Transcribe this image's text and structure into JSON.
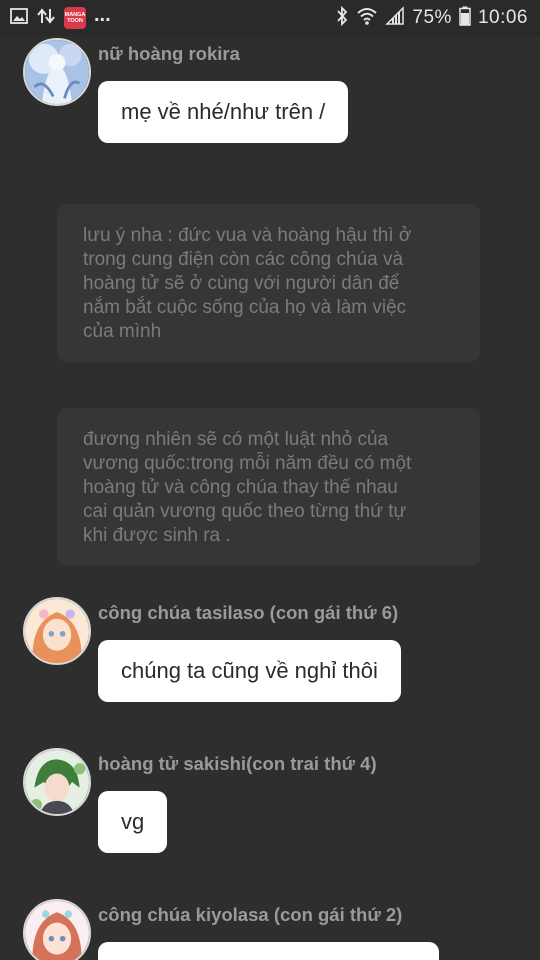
{
  "status_bar": {
    "left_icons": [
      "image-icon",
      "data-transfer-icon",
      "manga-toon-app-icon"
    ],
    "app_badge_text": [
      "MANGA",
      "TOON"
    ],
    "more": "...",
    "right_icons": [
      "bluetooth-icon",
      "wifi-icon",
      "signal-icon",
      "battery-icon"
    ],
    "battery": "75%",
    "time": "10:06"
  },
  "colors": {
    "background": "#2e2e2e",
    "bubble": "#ffffff",
    "narration_bg": "#363636",
    "sender_text": "#9a9a9a",
    "narration_text": "#7b7b7b"
  },
  "messages": [
    {
      "sender": "nữ hoàng rokira",
      "text": "mẹ về nhé/như trên /"
    },
    {
      "sender": "công chúa tasilaso (con gái thứ 6)",
      "text": "chúng ta cũng về nghỉ thôi"
    },
    {
      "sender": "hoàng tử sakishi(con trai thứ 4)",
      "text": "vg"
    },
    {
      "sender": "công chúa kiyolasa (con gái  thứ 2)",
      "text": ""
    }
  ],
  "narrations": [
    "lưu ý nha : đức vua và hoàng hậu thì ở\ntrong cung điện còn các công chúa và\nhoàng tử sẽ ở cùng với người dân để\nnắm bắt cuộc sống của họ và làm việc\ncủa mình",
    "đương nhiên sẽ có một luật nhỏ của\nvương quốc:trong mỗi năm đều có một\nhoàng tử và công chúa thay thế nhau\ncai quản vương quốc theo từng thứ tự\nkhi được sinh ra ."
  ]
}
